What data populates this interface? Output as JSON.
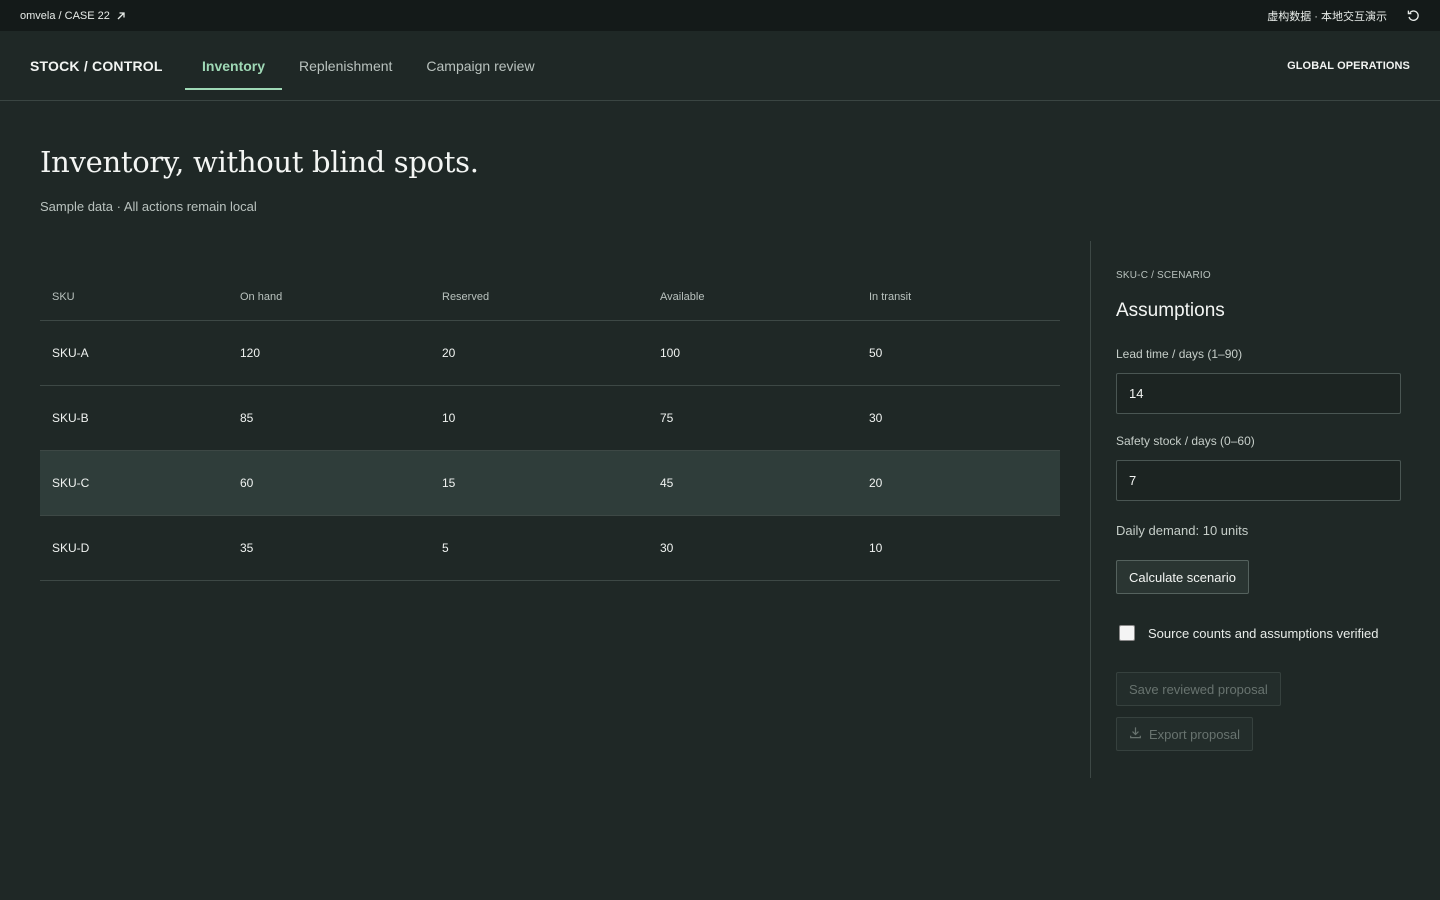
{
  "topbar": {
    "breadcrumb": "omvela / CASE 22",
    "notice": "虚构数据 · 本地交互演示"
  },
  "nav": {
    "brand": "STOCK / CONTROL",
    "tabs": [
      {
        "label": "Inventory",
        "active": true
      },
      {
        "label": "Replenishment",
        "active": false
      },
      {
        "label": "Campaign review",
        "active": false
      }
    ],
    "region": "GLOBAL OPERATIONS"
  },
  "page": {
    "title": "Inventory, without blind spots.",
    "subtitle": "Sample data · All actions remain local"
  },
  "table": {
    "headers": [
      "SKU",
      "On hand",
      "Reserved",
      "Available",
      "In transit"
    ],
    "rows": [
      [
        "SKU-A",
        "120",
        "20",
        "100",
        "50"
      ],
      [
        "SKU-B",
        "85",
        "10",
        "75",
        "30"
      ],
      [
        "SKU-C",
        "60",
        "15",
        "45",
        "20"
      ],
      [
        "SKU-D",
        "35",
        "5",
        "30",
        "10"
      ]
    ],
    "selected_row": 2
  },
  "panel": {
    "eyebrow": "SKU-C / SCENARIO",
    "title": "Assumptions",
    "lead_time_label": "Lead time / days (1–90)",
    "lead_time_value": "14",
    "safety_stock_label": "Safety stock / days (0–60)",
    "safety_stock_value": "7",
    "daily_demand": "Daily demand: 10 units",
    "calculate_label": "Calculate scenario",
    "verified_label": "Source counts and assumptions verified",
    "verified_checked": false,
    "save_label": "Save reviewed proposal",
    "export_label": "Export proposal"
  },
  "colors": {
    "accent": "#9fd9b6",
    "background": "#1f2826",
    "topbar": "#141a19",
    "selected_row": "#2f3d3a"
  }
}
